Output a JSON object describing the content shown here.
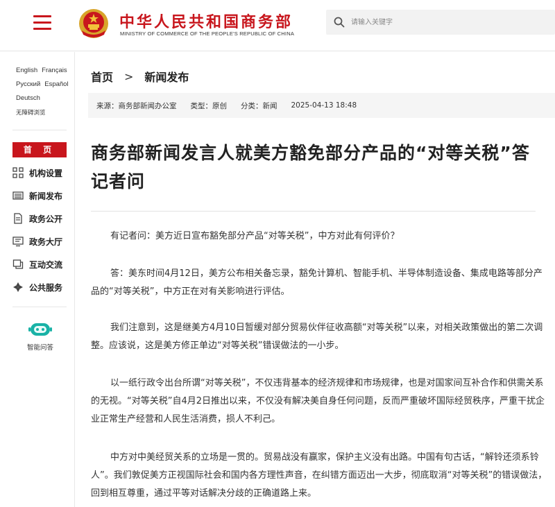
{
  "header": {
    "site_title": "中华人民共和国商务部",
    "site_subtitle": "MINISTRY OF COMMERCE OF THE PEOPLE'S REPUBLIC OF CHINA",
    "search_placeholder": "请输入关键字"
  },
  "sidebar": {
    "languages": [
      "English",
      "Français",
      "Русский",
      "Español",
      "Deutsch"
    ],
    "accessibility": "无障碍浏览",
    "home": "首 页",
    "nav": [
      {
        "label": "机构设置",
        "icon": "org-structure-icon"
      },
      {
        "label": "新闻发布",
        "icon": "news-icon"
      },
      {
        "label": "政务公开",
        "icon": "document-icon"
      },
      {
        "label": "政务大厅",
        "icon": "service-hall-icon"
      },
      {
        "label": "互动交流",
        "icon": "interaction-icon"
      },
      {
        "label": "公共服务",
        "icon": "public-service-icon"
      }
    ],
    "smart_qa": "智能问答",
    "accent_color": "#c8161d"
  },
  "breadcrumb": {
    "home": "首页",
    "separator": ">",
    "current": "新闻发布"
  },
  "meta": {
    "source": "来源：商务部新闻办公室",
    "type": "类型：原创",
    "category": "分类：新闻",
    "datetime": "2025-04-13 18:48"
  },
  "article": {
    "title": "商务部新闻发言人就美方豁免部分产品的“对等关税”答记者问",
    "paragraphs": [
      "有记者问：美方近日宣布豁免部分产品“对等关税”，中方对此有何评价？",
      "答：美东时间4月12日，美方公布相关备忘录，豁免计算机、智能手机、半导体制造设备、集成电路等部分产品的“对等关税”，中方正在对有关影响进行评估。",
      "我们注意到，这是继美方4月10日暂缓对部分贸易伙伴征收高额“对等关税”以来，对相关政策做出的第二次调整。应该说，这是美方修正单边“对等关税”错误做法的一小步。",
      "以一纸行政令出台所谓“对等关税”，不仅违背基本的经济规律和市场规律，也是对国家间互补合作和供需关系的无视。“对等关税”自4月2日推出以来，不仅没有解决美自身任何问题，反而严重破坏国际经贸秩序，严重干扰企业正常生产经营和人民生活消费，损人不利己。",
      "中方对中美经贸关系的立场是一贯的。贸易战没有赢家，保护主义没有出路。中国有句古话，“解铃还须系铃人”。我们敦促美方正视国际社会和国内各方理性声音，在纠错方面迈出一大步，彻底取消“对等关税”的错误做法，回到相互尊重，通过平等对话解决分歧的正确道路上来。"
    ]
  }
}
